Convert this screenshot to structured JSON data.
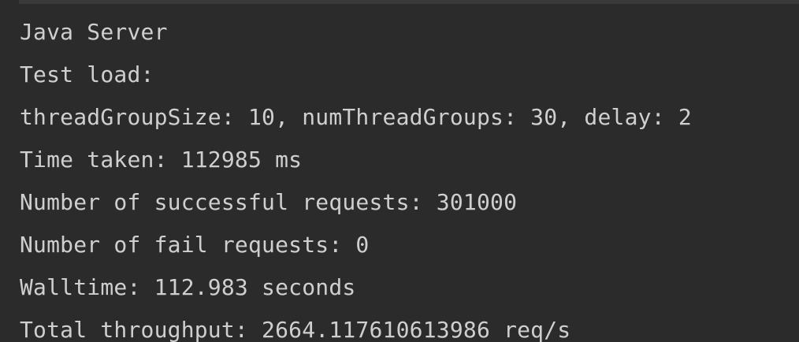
{
  "console": {
    "lines": [
      "Java Server",
      "Test load:",
      "threadGroupSize: 10, numThreadGroups: 30, delay: 2",
      "Time taken: 112985 ms",
      "Number of successful requests: 301000",
      "Number of fail requests: 0",
      "Walltime: 112.983 seconds",
      "Total throughput: 2664.117610613986 req/s"
    ]
  },
  "colors": {
    "background": "#2b2b2b",
    "text": "#cfcfcf",
    "divider": "#3a3a3a"
  }
}
